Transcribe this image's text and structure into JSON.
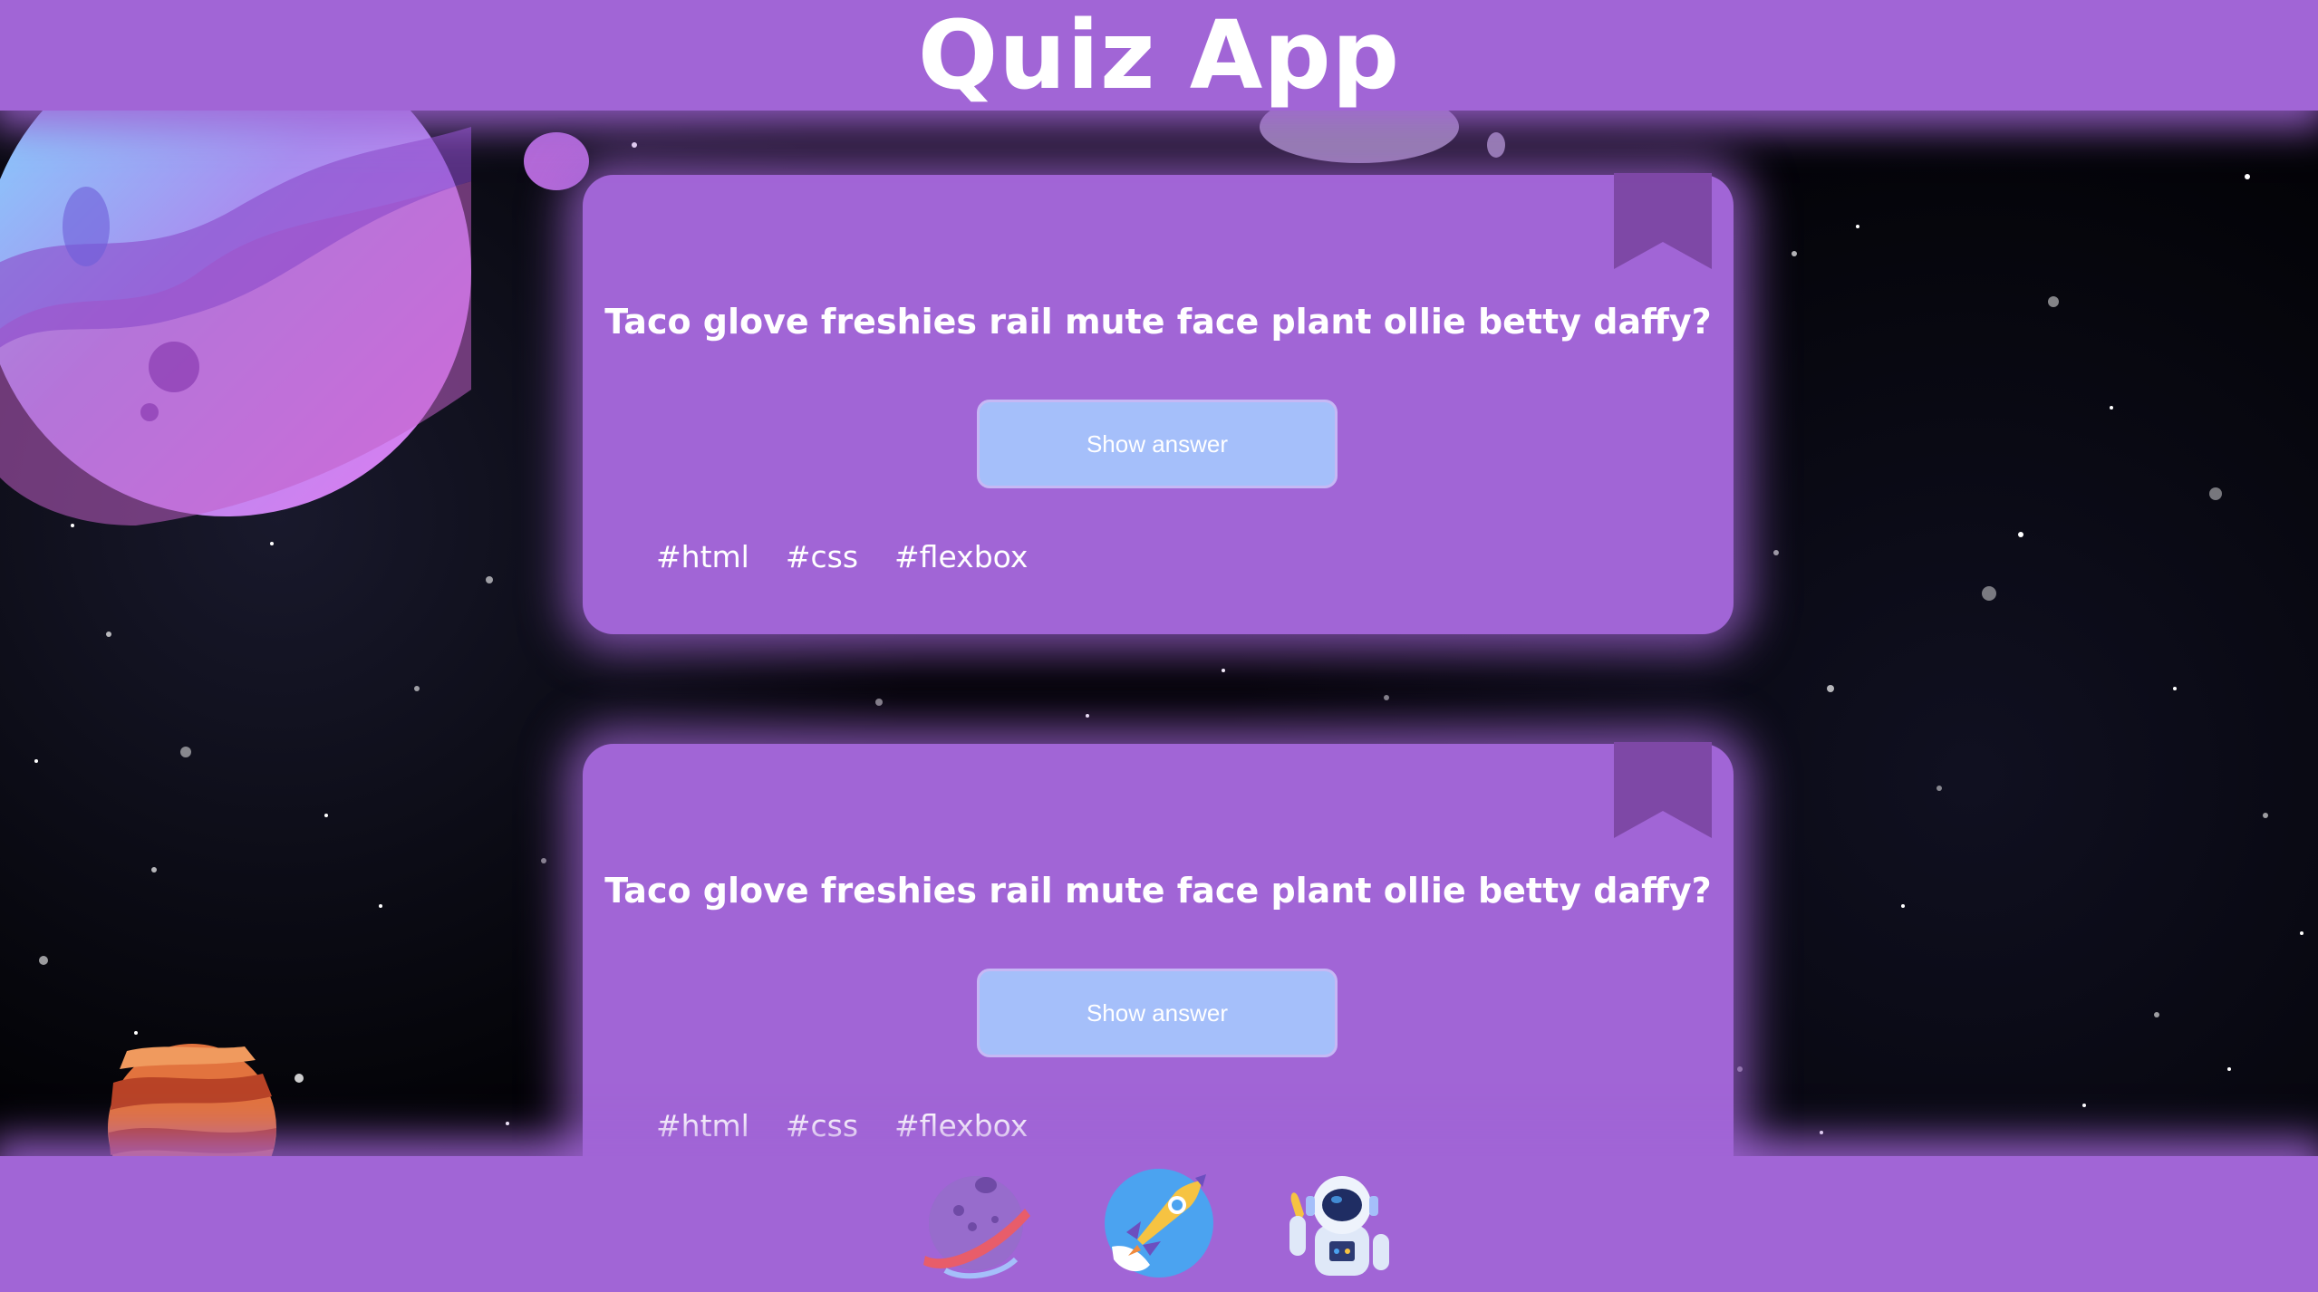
{
  "app": {
    "title": "Quiz App"
  },
  "colors": {
    "primary": "#a165d6",
    "button": "#a5bffa",
    "bookmark": "#7e48a6",
    "text": "#ffffff",
    "background": "#000000"
  },
  "cards": [
    {
      "question": "Taco glove freshies rail mute face plant ollie betty daffy?",
      "button_label": "Show answer",
      "bookmark_icon": "bookmark-icon",
      "tags": [
        "#html",
        "#css",
        "#flexbox"
      ]
    },
    {
      "question": "Taco glove freshies rail mute face plant ollie betty daffy?",
      "button_label": "Show answer",
      "bookmark_icon": "bookmark-icon",
      "tags": [
        "#html",
        "#css",
        "#flexbox"
      ]
    }
  ],
  "nav": {
    "items": [
      {
        "icon": "planet-icon"
      },
      {
        "icon": "rocket-icon"
      },
      {
        "icon": "astronaut-icon"
      }
    ]
  }
}
